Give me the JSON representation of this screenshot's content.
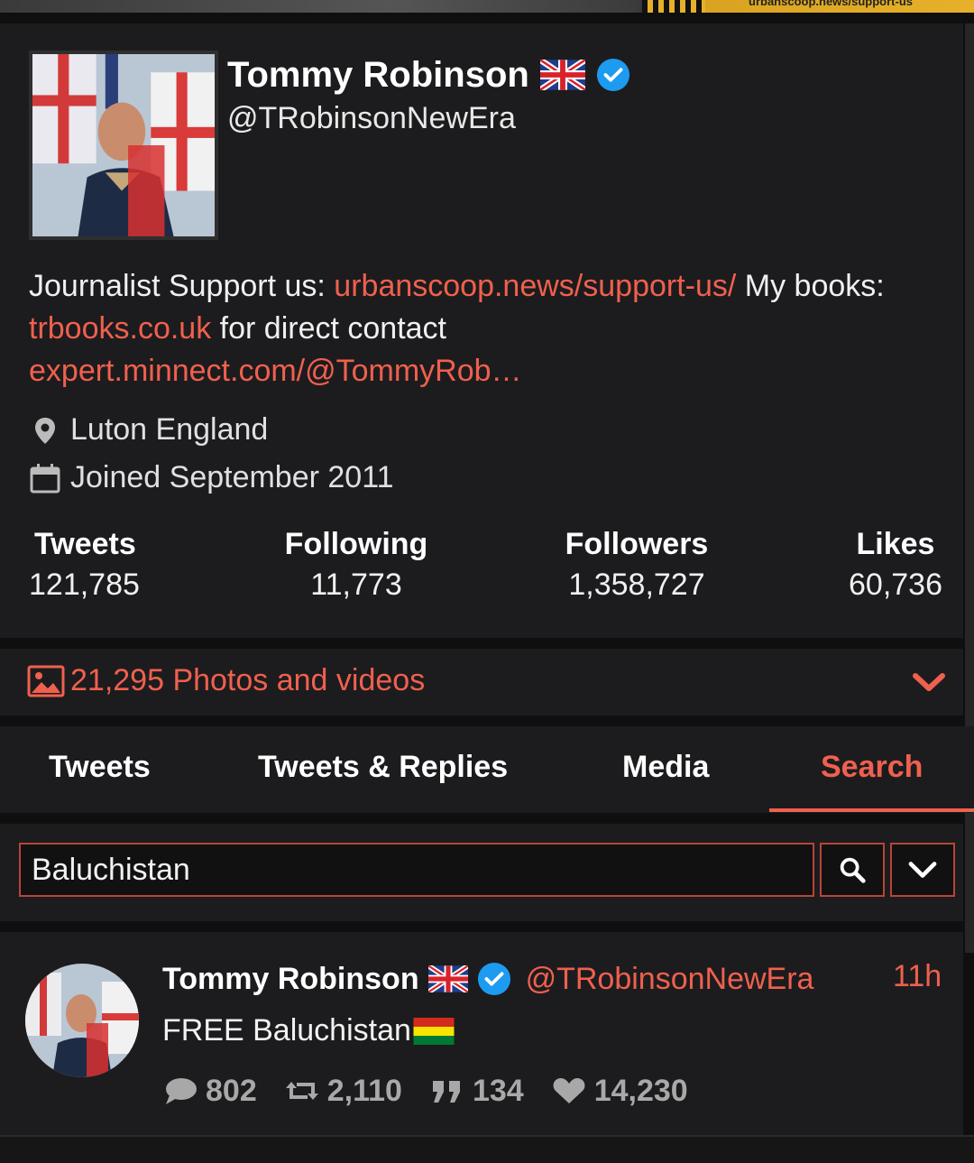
{
  "banner": {
    "url_text": "urbanscoop.news/support-us"
  },
  "profile": {
    "display_name": "Tommy Robinson",
    "handle": "@TRobinsonNewEra",
    "bio": {
      "t1": "Journalist Support us: ",
      "link1": "urbanscoop.news/support-us/",
      "t2": " My books: ",
      "link2": "trbooks.co.uk",
      "t3": " for direct contact ",
      "link3": "expert.minnect.com/@TommyRob…"
    },
    "location": "Luton England",
    "joined": "Joined September 2011",
    "stats": {
      "tweets_label": "Tweets",
      "tweets_value": "121,785",
      "following_label": "Following",
      "following_value": "11,773",
      "followers_label": "Followers",
      "followers_value": "1,358,727",
      "likes_label": "Likes",
      "likes_value": "60,736"
    }
  },
  "media_bar": {
    "label": "21,295 Photos and videos"
  },
  "tabs": [
    {
      "label": "Tweets"
    },
    {
      "label": "Tweets & Replies"
    },
    {
      "label": "Media"
    },
    {
      "label": "Search"
    }
  ],
  "active_tab": "Search",
  "search": {
    "value": "Baluchistan"
  },
  "tweet": {
    "name": "Tommy Robinson",
    "handle": "@TRobinsonNewEra",
    "time": "11h",
    "text": "FREE Baluchistan",
    "replies": "802",
    "retweets": "2,110",
    "quotes": "134",
    "likes": "14,230"
  },
  "colors": {
    "accent": "#f0604e",
    "background": "#0f0f0f",
    "card": "#1c1c1e",
    "verified": "#1d9bf0"
  },
  "icons": [
    "location-pin-icon",
    "calendar-icon",
    "image-icon",
    "chevron-down-icon",
    "search-icon",
    "reply-icon",
    "retweet-icon",
    "quote-icon",
    "heart-icon",
    "verified-icon",
    "uk-flag-icon",
    "bolivia-flag-icon"
  ]
}
